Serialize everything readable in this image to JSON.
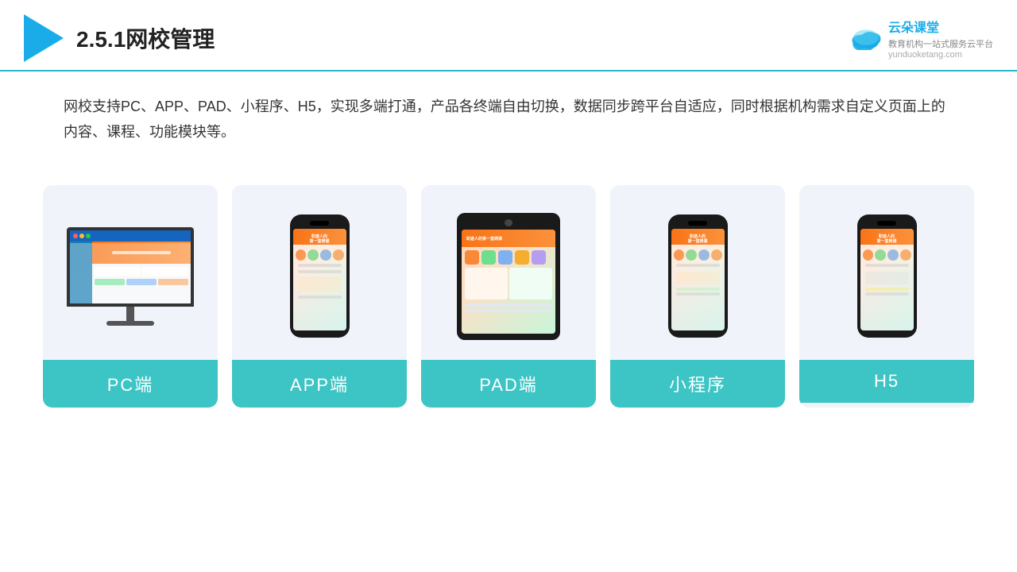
{
  "header": {
    "title": "2.5.1网校管理",
    "brand": {
      "name": "云朵课堂",
      "url": "yunduoketang.com",
      "tagline": "教育机构一站式服务云平台"
    }
  },
  "description": {
    "text": "网校支持PC、APP、PAD、小程序、H5，实现多端打通，产品各终端自由切换，数据同步跨平台自适应，同时根据机构需求自定义页面上的内容、课程、功能模块等。"
  },
  "cards": [
    {
      "id": "pc",
      "label": "PC端"
    },
    {
      "id": "app",
      "label": "APP端"
    },
    {
      "id": "pad",
      "label": "PAD端"
    },
    {
      "id": "miniprogram",
      "label": "小程序"
    },
    {
      "id": "h5",
      "label": "H5"
    }
  ],
  "colors": {
    "accent": "#3dc4c4",
    "header_line": "#2bb5c8",
    "title_color": "#222",
    "brand_color": "#1aace8"
  }
}
